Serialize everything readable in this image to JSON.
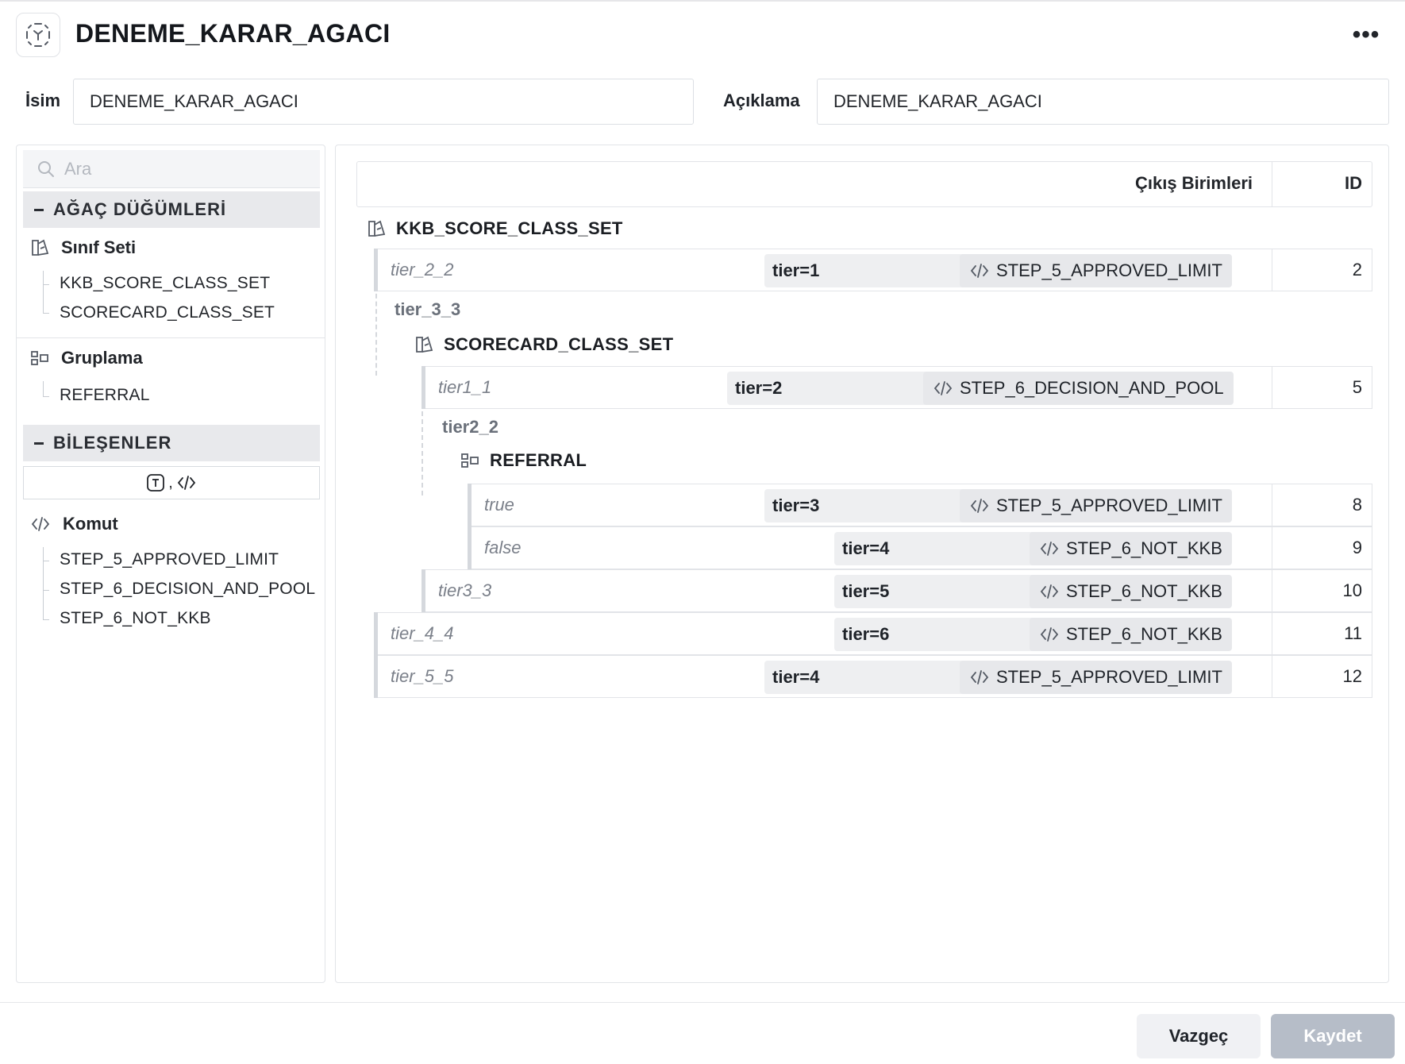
{
  "header": {
    "title": "DENEME_KARAR_AGACI",
    "more_label": "•••"
  },
  "form": {
    "name_label": "İsim",
    "name_value": "DENEME_KARAR_AGACI",
    "desc_label": "Açıklama",
    "desc_value": "DENEME_KARAR_AGACI"
  },
  "sidebar": {
    "search_placeholder": "Ara",
    "tree_nodes_header": "AĞAÇ DÜĞÜMLERİ",
    "class_set_title": "Sınıf Seti",
    "class_set_items": [
      "KKB_SCORE_CLASS_SET",
      "SCORECARD_CLASS_SET"
    ],
    "grouping_title": "Gruplama",
    "grouping_items": [
      "REFERRAL"
    ],
    "components_header": "BİLEŞENLER",
    "filter_separator": ",",
    "command_title": "Komut",
    "command_items": [
      "STEP_5_APPROVED_LIMIT",
      "STEP_6_DECISION_AND_POOL",
      "STEP_6_NOT_KKB"
    ]
  },
  "table": {
    "col_output": "Çıkış Birimleri",
    "col_id": "ID"
  },
  "tree": {
    "root_node": "KKB_SCORE_CLASS_SET",
    "branch_tier_3_3": "tier_3_3",
    "scorecard_node": "SCORECARD_CLASS_SET",
    "branch_tier2_2": "tier2_2",
    "referral_node": "REFERRAL"
  },
  "rows": [
    {
      "name": "tier_2_2",
      "condition": "tier=1",
      "step": "STEP_5_APPROVED_LIMIT",
      "id": "2"
    },
    {
      "name": "tier1_1",
      "condition": "tier=2",
      "step": "STEP_6_DECISION_AND_POOL",
      "id": "5"
    },
    {
      "name": "true",
      "condition": "tier=3",
      "step": "STEP_5_APPROVED_LIMIT",
      "id": "8"
    },
    {
      "name": "false",
      "condition": "tier=4",
      "step": "STEP_6_NOT_KKB",
      "id": "9"
    },
    {
      "name": "tier3_3",
      "condition": "tier=5",
      "step": "STEP_6_NOT_KKB",
      "id": "10"
    },
    {
      "name": "tier_4_4",
      "condition": "tier=6",
      "step": "STEP_6_NOT_KKB",
      "id": "11"
    },
    {
      "name": "tier_5_5",
      "condition": "tier=4",
      "step": "STEP_5_APPROVED_LIMIT",
      "id": "12"
    }
  ],
  "footer": {
    "cancel_label": "Vazgeç",
    "save_label": "Kaydet"
  }
}
